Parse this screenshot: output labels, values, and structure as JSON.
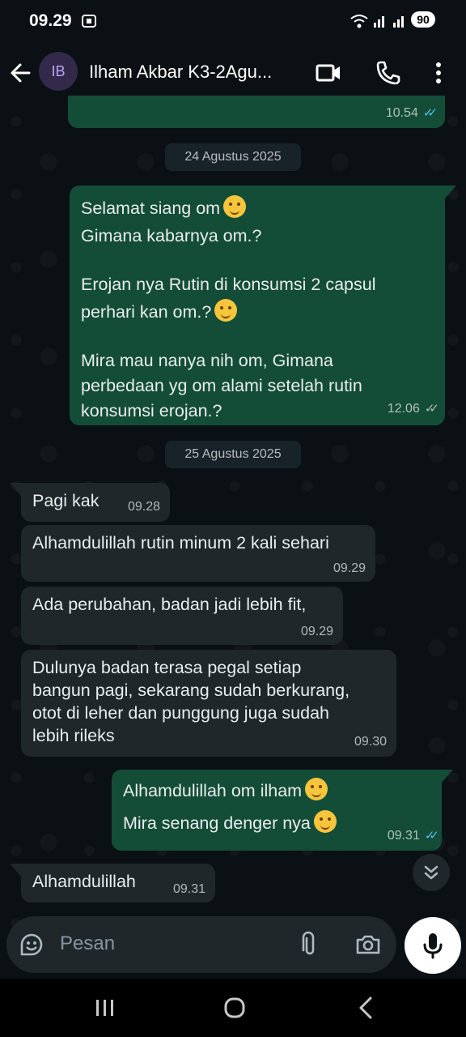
{
  "status": {
    "time": "09.29",
    "battery": "90"
  },
  "header": {
    "avatar_initials": "IB",
    "contact_name": "Ilham Akbar K3-2Agu..."
  },
  "chat": {
    "prev_time": "10.54",
    "date1": "24 Agustus 2025",
    "m1": {
      "line1": "Selamat siang om",
      "line2": "Gimana kabarnya om.?",
      "line3": "Erojan nya Rutin di konsumsi 2 capsul",
      "line4": "perhari kan om.?",
      "line5": "Mira mau nanya nih om, Gimana",
      "line6": "perbedaan yg om alami setelah rutin",
      "line7": "konsumsi erojan.?",
      "time": "12.06"
    },
    "date2": "25 Agustus 2025",
    "m2": {
      "text": "Pagi kak",
      "time": "09.28"
    },
    "m3": {
      "text": "Alhamdulillah rutin minum 2 kali sehari",
      "time": "09.29"
    },
    "m4": {
      "text": "Ada perubahan, badan jadi lebih fit,",
      "time": "09.29"
    },
    "m5": {
      "line1": "Dulunya badan terasa pegal setiap",
      "line2": "bangun pagi, sekarang sudah berkurang,",
      "line3": "otot di leher dan punggung juga sudah",
      "line4": "lebih rileks",
      "time": "09.30"
    },
    "m6": {
      "line1": "Alhamdulillah om ilham",
      "line2": "Mira senang denger nya",
      "time": "09.31"
    },
    "m7": {
      "text": "Alhamdulillah",
      "time": "09.31"
    }
  },
  "input": {
    "placeholder": "Pesan"
  },
  "icons": {
    "back": "arrow-left-icon",
    "video": "video-call-icon",
    "call": "phone-icon",
    "menu": "more-vertical-icon",
    "emoji": "emoji-icon",
    "attach": "paperclip-icon",
    "camera": "camera-icon",
    "mic": "microphone-icon",
    "scroll": "double-chevron-down-icon"
  },
  "colors": {
    "outgoing": "#144d37",
    "incoming": "#1f272a",
    "read_ticks": "#53bdeb",
    "background": "#0b1014"
  }
}
